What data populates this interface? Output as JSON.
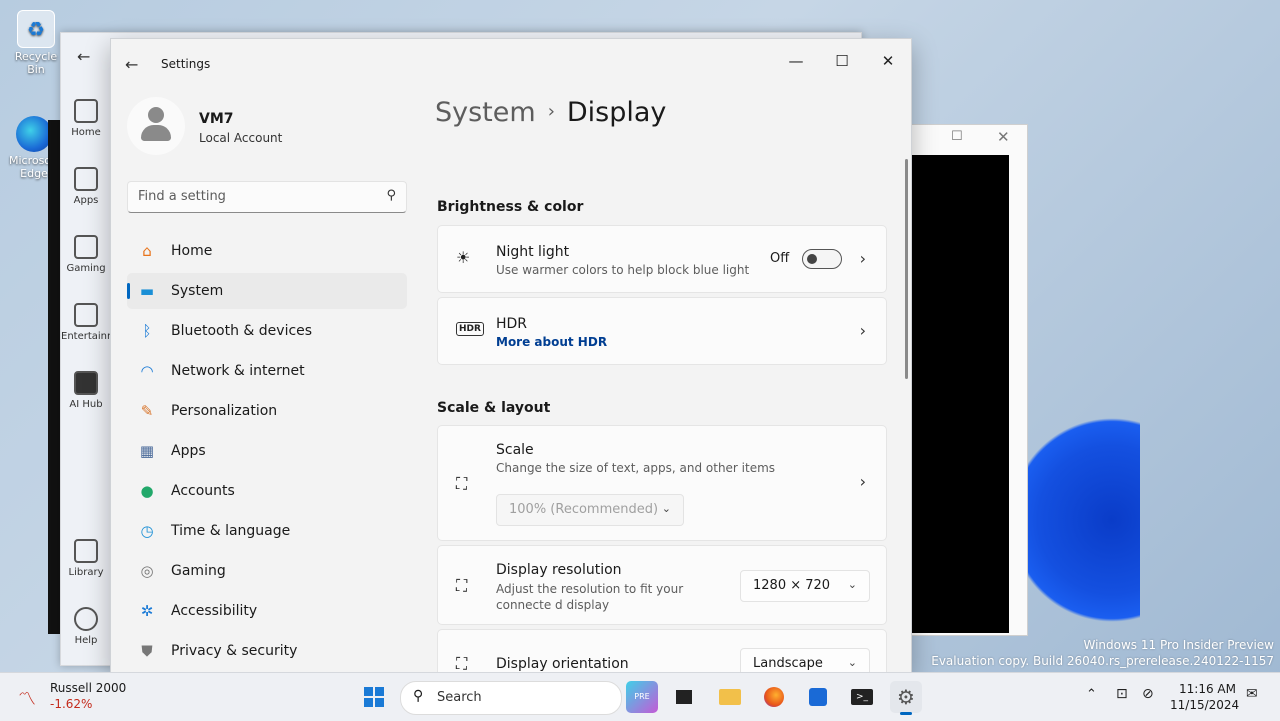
{
  "desktop": {
    "icons": [
      {
        "label": "Recycle Bin",
        "icon": "recycle-bin-icon"
      },
      {
        "label": "Microsoft Edge",
        "icon": "edge-icon"
      }
    ],
    "watermark": {
      "line1": "Windows 11 Pro Insider Preview",
      "line2": "Evaluation copy. Build 26040.rs_prerelease.240122-1157"
    }
  },
  "back_window": {
    "nav": [
      {
        "label": "Home",
        "icon": "home-icon"
      },
      {
        "label": "Apps",
        "icon": "apps-icon"
      },
      {
        "label": "Gaming",
        "icon": "gaming-icon"
      },
      {
        "label": "Entertainment",
        "icon": "entertainment-icon"
      },
      {
        "label": "AI Hub",
        "icon": "ai-hub-icon"
      }
    ],
    "nav_bottom": [
      {
        "label": "Library",
        "icon": "library-icon"
      },
      {
        "label": "Help",
        "icon": "help-icon"
      }
    ]
  },
  "settings": {
    "title": "Settings",
    "profile": {
      "name": "VM7",
      "account": "Local Account"
    },
    "search": {
      "placeholder": "Find a setting"
    },
    "nav": [
      {
        "label": "Home",
        "icon": "home-icon",
        "color": "#e8731a",
        "glyph": "⌂"
      },
      {
        "label": "System",
        "icon": "system-icon",
        "color": "#1a8fd6",
        "glyph": "▬",
        "selected": true
      },
      {
        "label": "Bluetooth & devices",
        "icon": "bluetooth-icon",
        "color": "#1a7ad6",
        "glyph": "ᛒ"
      },
      {
        "label": "Network & internet",
        "icon": "wifi-icon",
        "color": "#1a7ad6",
        "glyph": "◠"
      },
      {
        "label": "Personalization",
        "icon": "brush-icon",
        "color": "#d8742a",
        "glyph": "✎"
      },
      {
        "label": "Apps",
        "icon": "apps-icon",
        "color": "#4a6a9a",
        "glyph": "▦"
      },
      {
        "label": "Accounts",
        "icon": "accounts-icon",
        "color": "#22a86a",
        "glyph": "●"
      },
      {
        "label": "Time & language",
        "icon": "globe-clock-icon",
        "color": "#1a8fd6",
        "glyph": "◷"
      },
      {
        "label": "Gaming",
        "icon": "gamepad-icon",
        "color": "#777777",
        "glyph": "◎"
      },
      {
        "label": "Accessibility",
        "icon": "accessibility-icon",
        "color": "#1a7ad6",
        "glyph": "✲"
      },
      {
        "label": "Privacy & security",
        "icon": "shield-icon",
        "color": "#777777",
        "glyph": "⛊"
      }
    ],
    "breadcrumb": {
      "parent": "System",
      "current": "Display"
    },
    "sections": {
      "brightness": "Brightness & color",
      "scale_layout": "Scale & layout"
    },
    "cards": {
      "night_light": {
        "title": "Night light",
        "subtitle": "Use warmer colors to help block blue light",
        "state": "Off"
      },
      "hdr": {
        "title": "HDR",
        "link": "More about HDR"
      },
      "scale": {
        "title": "Scale",
        "subtitle": "Change the size of text, apps, and other items",
        "value": "100% (Recommended)"
      },
      "resolution": {
        "title": "Display resolution",
        "subtitle": "Adjust the resolution to fit your connecte d display",
        "value": "1280 × 720"
      },
      "orientation": {
        "title": "Display orientation",
        "value": "Landscape"
      }
    }
  },
  "taskbar": {
    "stock": {
      "name": "Russell 2000",
      "change": "-1.62%",
      "change_color": "#c42b1c"
    },
    "search_placeholder": "Search",
    "clock": {
      "time": "11:16 AM",
      "date": "11/15/2024"
    }
  }
}
